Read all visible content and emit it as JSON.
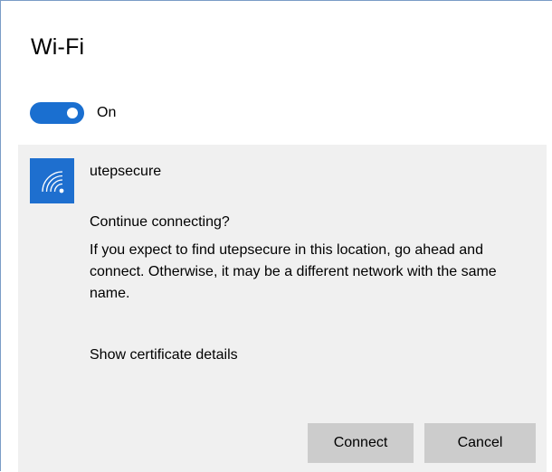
{
  "header": {
    "title": "Wi-Fi"
  },
  "wifi_toggle": {
    "label": "On",
    "state": "on",
    "color": "#1a6fd0"
  },
  "network": {
    "icon": "wifi-signal-icon",
    "icon_color": "#1e6fcf",
    "name": "utepsecure",
    "prompt": "Continue connecting?",
    "description": "If you expect to find utepsecure in this location, go ahead and connect. Otherwise, it may be a different network with the same name.",
    "certificate_link": "Show certificate details"
  },
  "buttons": {
    "connect": "Connect",
    "cancel": "Cancel"
  }
}
